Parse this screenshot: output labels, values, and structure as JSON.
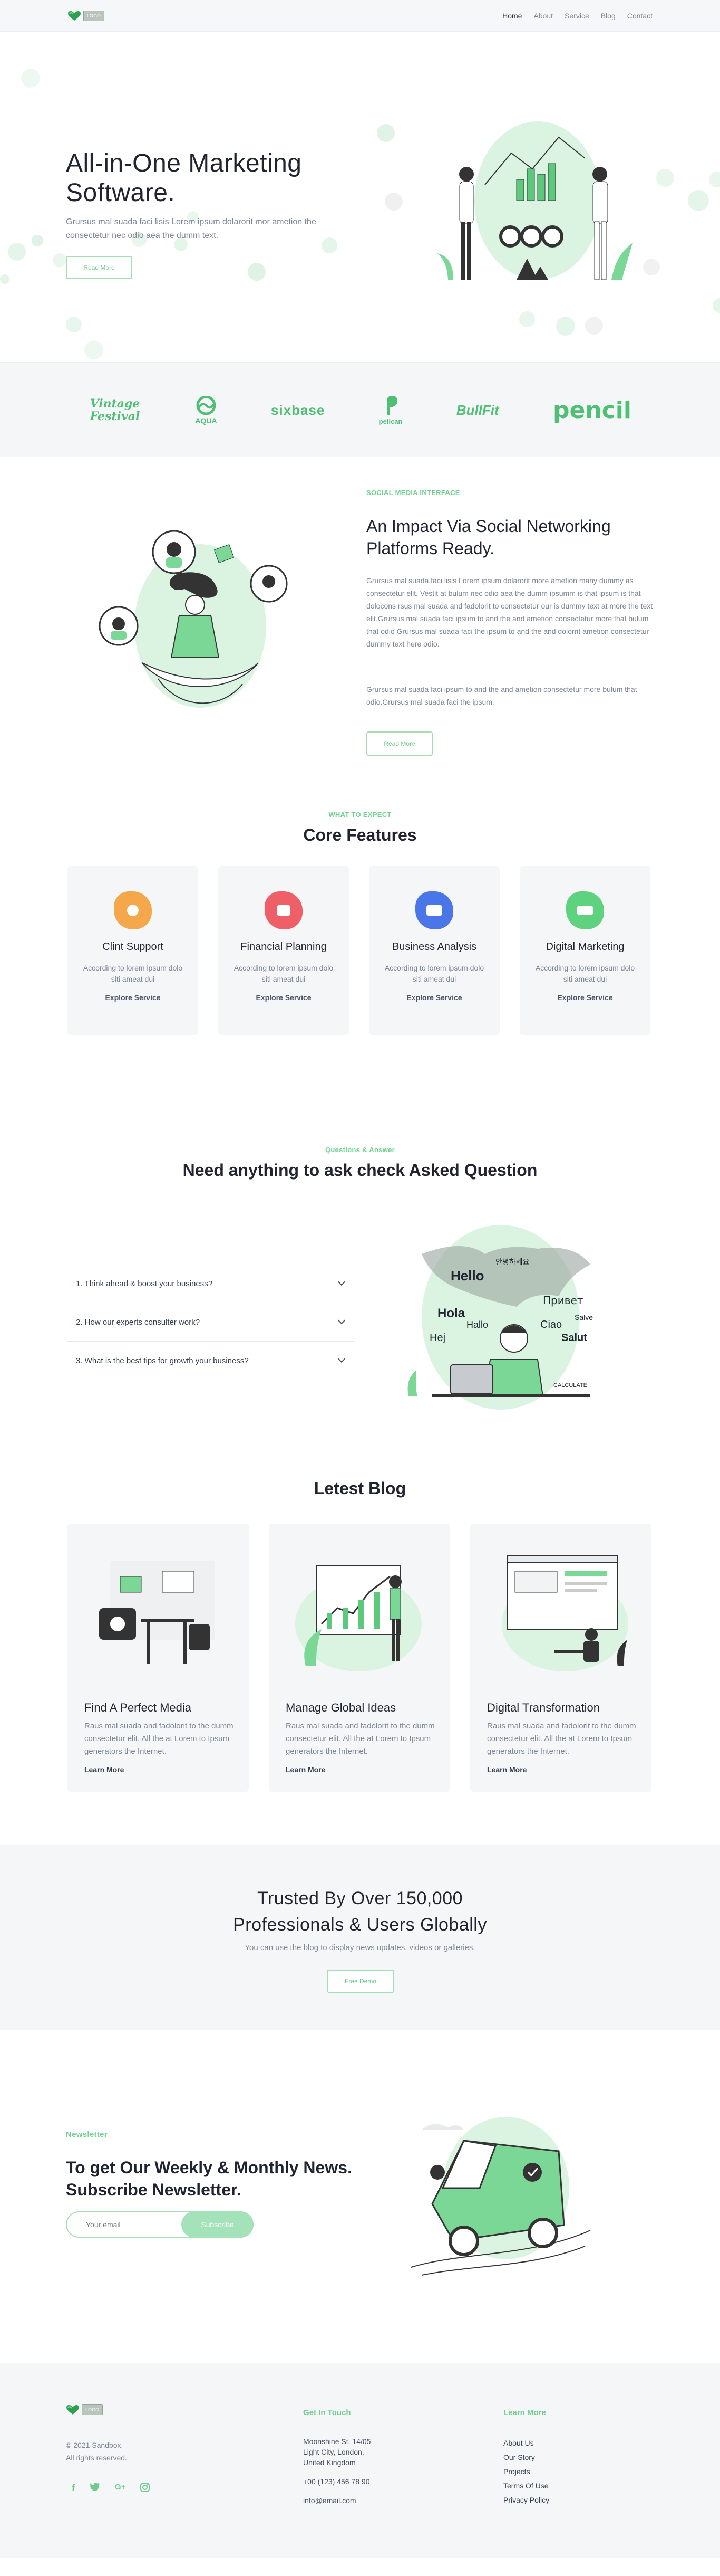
{
  "nav": {
    "logo_text": "LOGO",
    "items": [
      {
        "label": "Home",
        "active": true
      },
      {
        "label": "About"
      },
      {
        "label": "Service"
      },
      {
        "label": "Blog"
      },
      {
        "label": "Contact"
      }
    ]
  },
  "hero": {
    "title": "All-in-One Marketing Software.",
    "text": "Grursus mal suada faci lisis Lorem ipsum dolarorit mor ametion the consectetur nec odio aea the dumm text.",
    "button": "Read More"
  },
  "brands": [
    "Vintage Festival",
    "AQUA",
    "sixbase",
    "pelican",
    "BullFit",
    "pencil"
  ],
  "social": {
    "eyebrow": "SOCIAL MEDIA INTERFACE",
    "title": "An Impact Via Social Networking Platforms Ready.",
    "text1": "Grursus mal suada faci lisis Lorem ipsum dolarorit more ametion many dummy as consectetur elit. Vestit at bulum nec odio aea the dumm ipsumm is that ipsum is that dolocons rsus mal suada and fadolorit to consectetur our is dummy text at more the text elit.Grursus mal suada faci ipsum to and the and ametion consectetur more that bulum that odio Grursus mal suada faci the ipsum to and the and dolorrit ametion consectetur dummy text here odio.",
    "text2": "Grursus mal suada faci ipsum to and the and ametion consectetur more bulum that odio.Grursus mal suada faci the ipsum.",
    "button": "Read More"
  },
  "features": {
    "eyebrow": "WHAT TO EXPECT",
    "title": "Core Features",
    "items": [
      {
        "title": "Clint Support",
        "text": "According to lorem ipsum dolo siti ameat dui",
        "link": "Explore Service",
        "color": "#f5a74b"
      },
      {
        "title": "Financial Planning",
        "text": "According to lorem ipsum dolo siti ameat dui",
        "link": "Explore Service",
        "color": "#ef5f68"
      },
      {
        "title": "Business Analysis",
        "text": "According to lorem ipsum dolo siti ameat dui",
        "link": "Explore Service",
        "color": "#4a76e8"
      },
      {
        "title": "Digital Marketing",
        "text": "According to lorem ipsum dolo siti ameat dui",
        "link": "Explore Service",
        "color": "#5fd27f"
      }
    ]
  },
  "faq": {
    "eyebrow": "Questions & Answer",
    "title": "Need anything to ask check Asked Question",
    "questions": [
      "1. Think ahead & boost your business?",
      "2. How our experts consulter work?",
      "3. What is the best tips for growth your business?"
    ],
    "map_words": [
      "Hello",
      "Hola",
      "Hallo",
      "Hej",
      "Привет",
      "Ciao",
      "Salut",
      "Salve",
      "안녕하세요",
      "CALCULATE"
    ]
  },
  "blog": {
    "title": "Letest Blog",
    "posts": [
      {
        "title": "Find A Perfect Media",
        "text": "Raus mal suada and fadolorit to the dumm consectetur elit. All the at Lorem to Ipsum generators the Internet.",
        "link": "Learn More"
      },
      {
        "title": "Manage Global Ideas",
        "text": "Raus mal suada and fadolorit to the dumm consectetur elit. All the at Lorem to Ipsum generators the Internet.",
        "link": "Learn More"
      },
      {
        "title": "Digital Transformation",
        "text": "Raus mal suada and fadolorit to the dumm consectetur elit. All the at Lorem to Ipsum generators the Internet.",
        "link": "Learn More"
      }
    ]
  },
  "trust": {
    "title_line1": "Trusted By Over 150,000",
    "title_line2": "Professionals & Users Globally",
    "text": "You can use the blog to display news updates, videos or galleries.",
    "button": "Free Demo"
  },
  "newsletter": {
    "eyebrow": "Newsletter",
    "title": "To get Our Weekly & Monthly News. Subscribe Newsletter.",
    "placeholder": "Your email",
    "button": "Subscribe"
  },
  "footer": {
    "copyright_line1": "© 2021 Sandbox.",
    "copyright_line2": "All rights reserved.",
    "social_icons": [
      "facebook-icon",
      "twitter-icon",
      "google-plus-icon",
      "instagram-icon"
    ],
    "contact": {
      "heading": "Get In Touch",
      "address1": "Moonshine St. 14/05",
      "address2": "Light City, London,",
      "address3": "United Kingdom",
      "phone": "+00 (123) 456 78 90",
      "email": "info@email.com"
    },
    "learn": {
      "heading": "Learn More",
      "links": [
        "About Us",
        "Our Story",
        "Projects",
        "Terms Of Use",
        "Privacy Policy"
      ]
    }
  },
  "colors": {
    "accent": "#6fd08f",
    "accent_light": "#d7f3df",
    "dark": "#1f2430",
    "muted": "#7d8695",
    "bg_soft": "#f5f6f8"
  }
}
